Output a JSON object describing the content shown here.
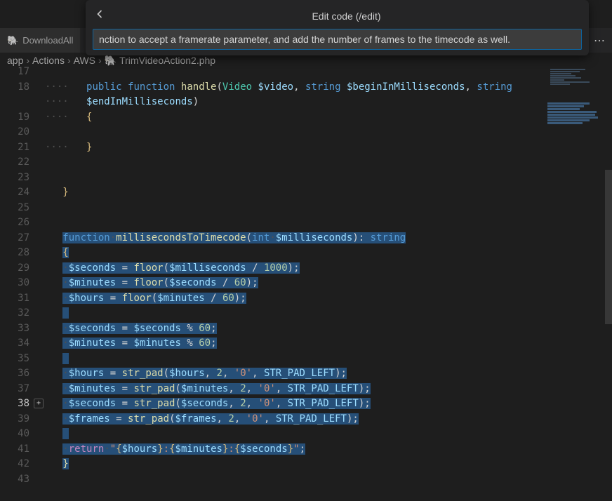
{
  "dialog": {
    "title": "Edit code (/edit)",
    "input_value": "nction to accept a framerate parameter, and add the number of frames to the timecode as well."
  },
  "tab": {
    "icon": "🐘",
    "label": "DownloadAll"
  },
  "actions_more": "⋯",
  "breadcrumbs": {
    "p0": "app",
    "p1": "Actions",
    "p2": "AWS",
    "icon": "🐘",
    "p3": "TrimVideoAction2.php",
    "sep": "›"
  },
  "line_numbers": [
    "17",
    "18",
    "19",
    "20",
    "21",
    "22",
    "23",
    "24",
    "25",
    "26",
    "27",
    "28",
    "29",
    "30",
    "31",
    "32",
    "33",
    "34",
    "35",
    "36",
    "37",
    "38",
    "39",
    "40",
    "41",
    "42",
    "43"
  ],
  "hover_line_index": 21,
  "code": {
    "l18": {
      "kw1": "public",
      "kw2": "function",
      "fn": "handle",
      "op": "(",
      "cls": "Video",
      "sp": " ",
      "v1": "$video",
      "cm": ", ",
      "kw3": "string",
      "v2": "$beginInMilliseconds",
      "cm2": ", ",
      "kw4": "string"
    },
    "l18b": {
      "v": "$endInMilliseconds",
      "cp": ")"
    },
    "l19": {
      "br": "{"
    },
    "l21": {
      "br": "}"
    },
    "l24": {
      "br": "}"
    },
    "l27": {
      "kw": "function",
      "sp": " ",
      "fn": "millisecondsToTimecode",
      "op": "(",
      "t": "int",
      "sp2": " ",
      "v": "$milliseconds",
      "cp": ")",
      "col": ": ",
      "ret": "string"
    },
    "l28": {
      "br": "{"
    },
    "l29": {
      "v": "$seconds",
      "eq": " = ",
      "fn": "floor",
      "op": "(",
      "v2": "$milliseconds",
      "div": " / ",
      "n": "1000",
      "cp": ");"
    },
    "l30": {
      "v": "$minutes",
      "eq": " = ",
      "fn": "floor",
      "op": "(",
      "v2": "$seconds",
      "div": " / ",
      "n": "60",
      "cp": ");"
    },
    "l31": {
      "v": "$hours",
      "eq": " = ",
      "fn": "floor",
      "op": "(",
      "v2": "$minutes",
      "div": " / ",
      "n": "60",
      "cp": ");"
    },
    "l33": {
      "v": "$seconds",
      "eq": " = ",
      "v2": "$seconds",
      "mod": " % ",
      "n": "60",
      "sc": ";"
    },
    "l34": {
      "v": "$minutes",
      "eq": " = ",
      "v2": "$minutes",
      "mod": " % ",
      "n": "60",
      "sc": ";"
    },
    "l36": {
      "v": "$hours",
      "eq": " = ",
      "fn": "str_pad",
      "op": "(",
      "v2": "$hours",
      "cm": ", ",
      "n": "2",
      "cm2": ", ",
      "s": "'0'",
      "cm3": ", ",
      "ct": "STR_PAD_LEFT",
      "cp": ");"
    },
    "l37": {
      "v": "$minutes",
      "eq": " = ",
      "fn": "str_pad",
      "op": "(",
      "v2": "$minutes",
      "cm": ", ",
      "n": "2",
      "cm2": ", ",
      "s": "'0'",
      "cm3": ", ",
      "ct": "STR_PAD_LEFT",
      "cp": ");"
    },
    "l38": {
      "v": "$seconds",
      "eq": " = ",
      "fn": "str_pad",
      "op": "(",
      "v2": "$seconds",
      "cm": ", ",
      "n": "2",
      "cm2": ", ",
      "s": "'0'",
      "cm3": ", ",
      "ct": "STR_PAD_LEFT",
      "cp": ");"
    },
    "l39": {
      "v": "$frames",
      "eq": " = ",
      "fn": "str_pad",
      "op": "(",
      "v2": "$frames",
      "cm": ", ",
      "n": "2",
      "cm2": ", ",
      "s": "'0'",
      "cm3": ", ",
      "ct": "STR_PAD_LEFT",
      "cp": ");"
    },
    "l41": {
      "kw": "return",
      "sp": " ",
      "q": "\"",
      "br": "{",
      "v1": "$hours",
      "cb": "}",
      "col": ":",
      "br2": "{",
      "v2": "$minutes",
      "cb2": "}",
      "col2": ":",
      "br3": "{",
      "v3": "$seconds",
      "cb3": "}",
      "q2": "\"",
      "sc": ";"
    },
    "l42": {
      "br": "}"
    }
  }
}
